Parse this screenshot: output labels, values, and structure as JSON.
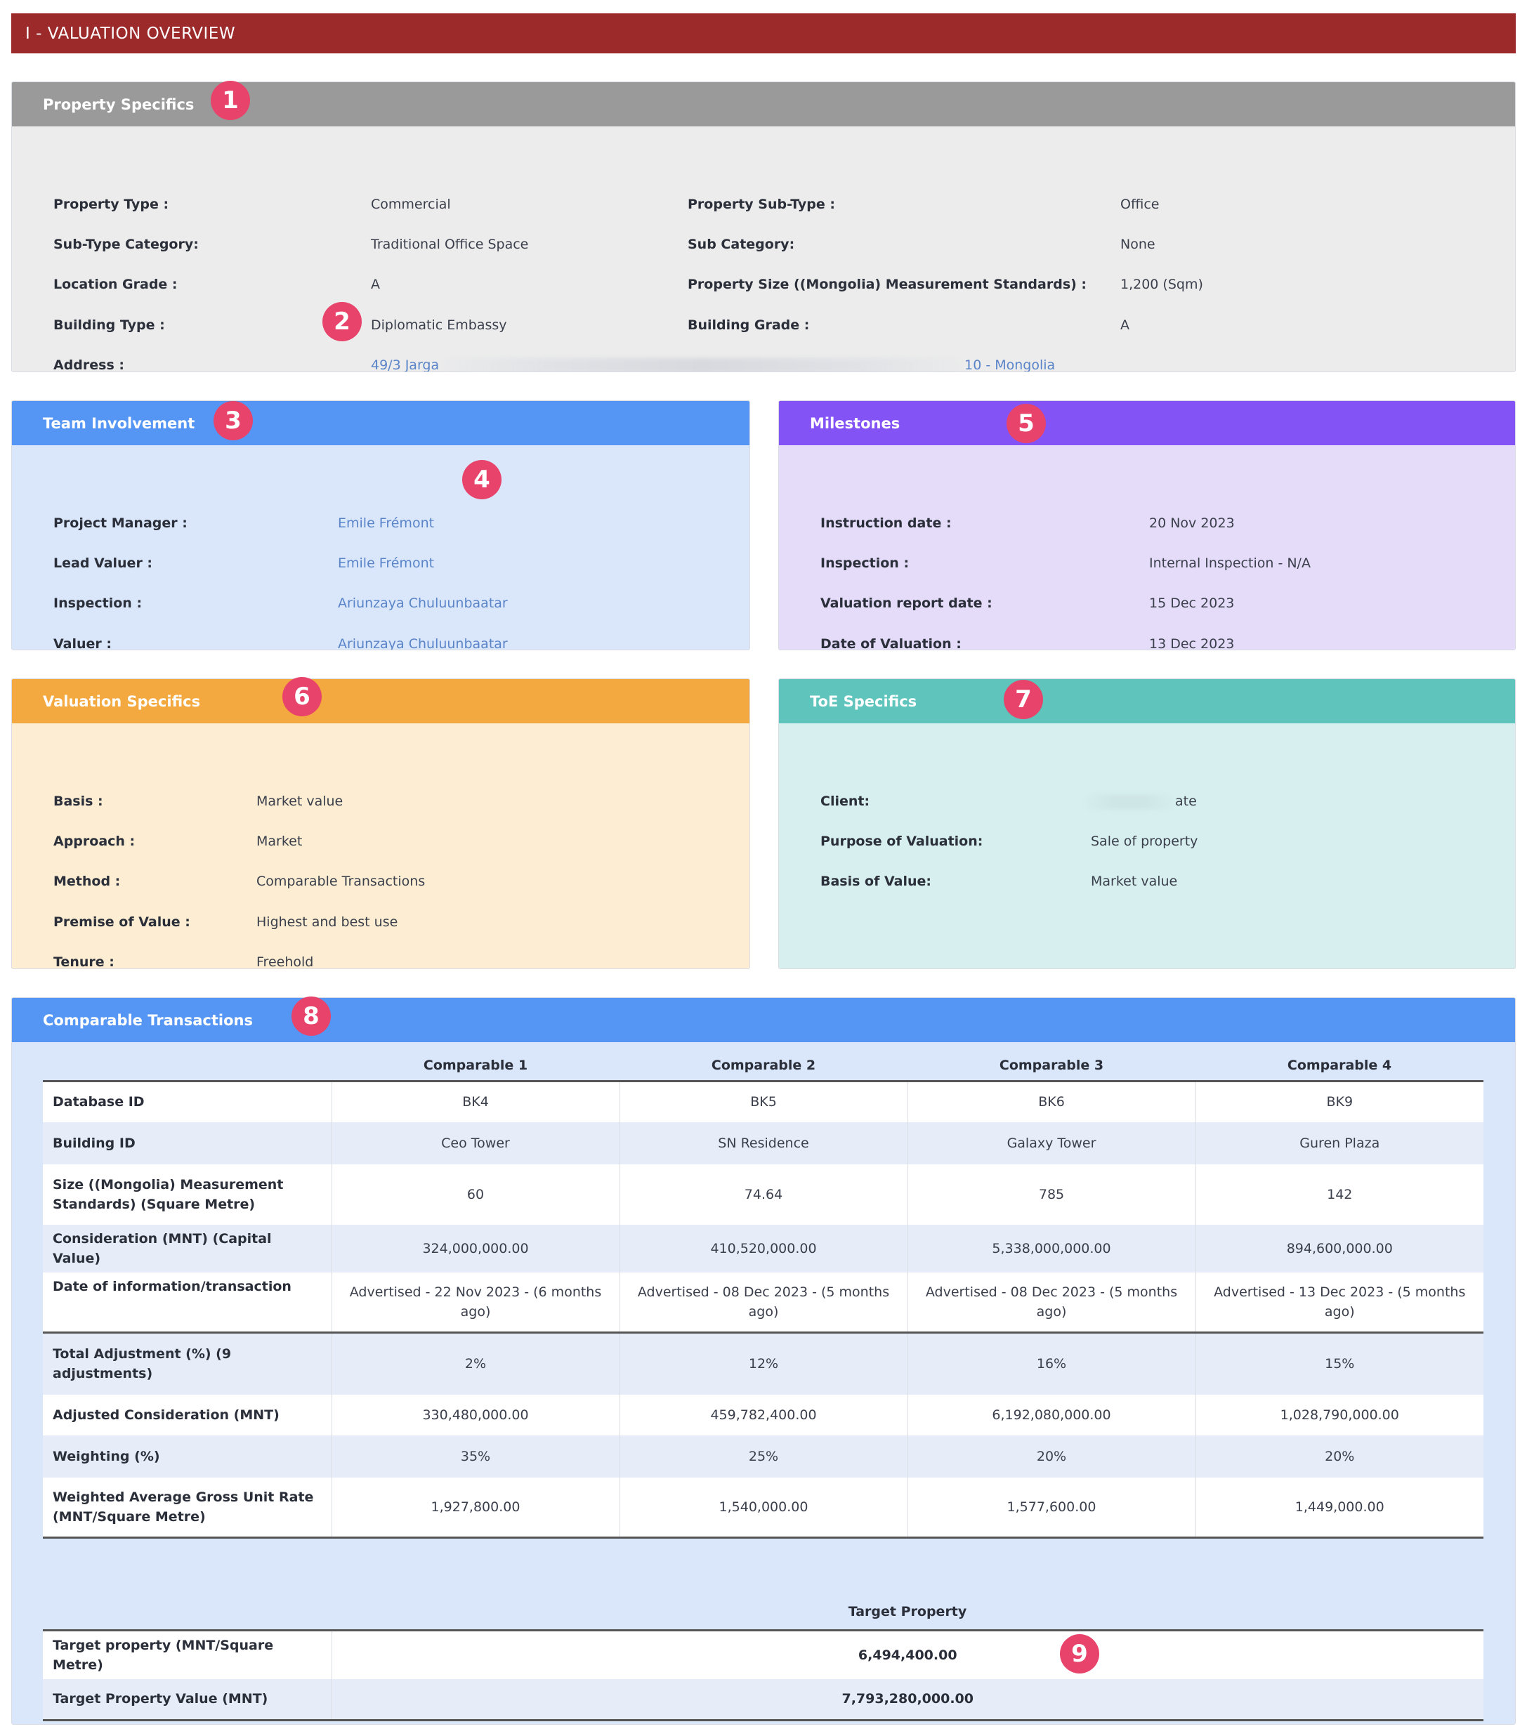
{
  "header": {
    "title": "I - VALUATION OVERVIEW"
  },
  "colors": {
    "header": "#9c2a2a",
    "grey": "#9a9a9a",
    "blue": "#5596f5",
    "purple": "#8453f5",
    "orange": "#f3a93f",
    "teal": "#5ec4bc",
    "marker": "#e8436b"
  },
  "markers": [
    "1",
    "2",
    "3",
    "4",
    "5",
    "6",
    "7",
    "8",
    "9"
  ],
  "property": {
    "title": "Property Specifics",
    "rows": [
      {
        "l1": "Property Type :",
        "v1": "Commercial",
        "l2": "Property Sub-Type :",
        "v2": "Office"
      },
      {
        "l1": "Sub-Type Category:",
        "v1": "Traditional Office Space",
        "l2": "Sub Category:",
        "v2": "None"
      },
      {
        "l1": "Location Grade :",
        "v1": "A",
        "l2": "Property Size ((Mongolia) Measurement Standards) :",
        "v2": "1,200 (Sqm)"
      },
      {
        "l1": "Building Type :",
        "v1": "Diplomatic Embassy",
        "l2": "Building Grade :",
        "v2": "A"
      }
    ],
    "address_label": "Address :",
    "address_start": "49/3 Jarga",
    "address_end": "10 - Mongolia"
  },
  "team": {
    "title": "Team Involvement",
    "rows": [
      {
        "label": "Project Manager :",
        "value": "Emile Frémont"
      },
      {
        "label": "Lead Valuer :",
        "value": "Emile Frémont"
      },
      {
        "label": "Inspection :",
        "value": "Ariunzaya Chuluunbaatar"
      },
      {
        "label": "Valuer :",
        "value": "Ariunzaya Chuluunbaatar"
      }
    ]
  },
  "milestones": {
    "title": "Milestones",
    "rows": [
      {
        "label": "Instruction date :",
        "value": "20 Nov 2023"
      },
      {
        "label": "Inspection :",
        "value": "Internal Inspection - N/A"
      },
      {
        "label": "Valuation report date :",
        "value": "15 Dec 2023"
      },
      {
        "label": "Date of Valuation :",
        "value": "13 Dec 2023"
      }
    ]
  },
  "valuation": {
    "title": "Valuation Specifics",
    "rows": [
      {
        "label": "Basis :",
        "value": "Market value"
      },
      {
        "label": "Approach :",
        "value": "Market"
      },
      {
        "label": "Method :",
        "value": "Comparable Transactions"
      },
      {
        "label": "Premise of Value :",
        "value": "Highest and best use"
      },
      {
        "label": "Tenure :",
        "value": "Freehold"
      }
    ]
  },
  "toe": {
    "title": "ToE Specifics",
    "client_label": "Client:",
    "client_tail": "ate",
    "rows": [
      {
        "label": "Purpose of Valuation:",
        "value": "Sale of property"
      },
      {
        "label": "Basis of Value:",
        "value": "Market value"
      }
    ]
  },
  "comparables": {
    "title": "Comparable Transactions",
    "headers": [
      "Comparable 1",
      "Comparable 2",
      "Comparable 3",
      "Comparable 4"
    ],
    "rows": [
      {
        "label": "Database ID",
        "values": [
          "BK4",
          "BK5",
          "BK6",
          "BK9"
        ]
      },
      {
        "label": "Building ID",
        "values": [
          "Ceo Tower",
          "SN Residence",
          "Galaxy Tower",
          "Guren Plaza"
        ]
      },
      {
        "label": "Size ((Mongolia) Measurement Standards) (Square Metre)",
        "values": [
          "60",
          "74.64",
          "785",
          "142"
        ]
      },
      {
        "label": "Consideration (MNT) (Capital Value)",
        "values": [
          "324,000,000.00",
          "410,520,000.00",
          "5,338,000,000.00",
          "894,600,000.00"
        ]
      },
      {
        "label": "Date of information/transaction",
        "values": [
          "Advertised - 22 Nov 2023 - (6 months ago)",
          "Advertised - 08 Dec 2023 - (5 months ago)",
          "Advertised - 08 Dec 2023 - (5 months ago)",
          "Advertised - 13 Dec 2023 - (5 months ago)"
        ]
      },
      {
        "label": "Total Adjustment (%) (9 adjustments)",
        "values": [
          "2%",
          "12%",
          "16%",
          "15%"
        ]
      },
      {
        "label": "Adjusted Consideration (MNT)",
        "values": [
          "330,480,000.00",
          "459,782,400.00",
          "6,192,080,000.00",
          "1,028,790,000.00"
        ]
      },
      {
        "label": "Weighting (%)",
        "values": [
          "35%",
          "25%",
          "20%",
          "20%"
        ]
      },
      {
        "label": "Weighted Average Gross Unit Rate (MNT/Square Metre)",
        "values": [
          "1,927,800.00",
          "1,540,000.00",
          "1,577,600.00",
          "1,449,000.00"
        ]
      }
    ],
    "target_header": "Target Property",
    "target_rows": [
      {
        "label": "Target property (MNT/Square Metre)",
        "value": "6,494,400.00"
      },
      {
        "label": "Target Property Value (MNT)",
        "value": "7,793,280,000.00"
      }
    ]
  }
}
